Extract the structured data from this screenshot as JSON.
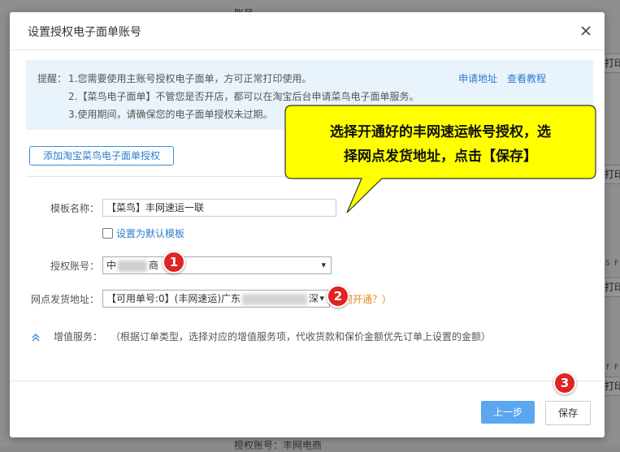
{
  "background": {
    "top_label": "账号",
    "bottom_label": "授权账号：丰网电商",
    "print_label": "打印",
    "snippet_a": "S F",
    "snippet_b": "f F"
  },
  "dialog": {
    "title": "设置授权电子面单账号",
    "close_icon": "close-icon"
  },
  "tips": {
    "label": "提醒：",
    "lines": [
      "1.您需要使用主账号授权电子面单，方可正常打印使用。",
      "2.【菜鸟电子面单】不管您是否开店，都可以在淘宝后台申请菜鸟电子面单服务。",
      "3.使用期间，请确保您的电子面单授权未过期。"
    ],
    "apply_link": "申请地址",
    "tutorial_link": "查看教程"
  },
  "add_auth_button": "添加淘宝菜鸟电子面单授权",
  "form": {
    "template_label": "模板名称：",
    "template_value": "【菜鸟】丰网速运一联",
    "default_checkbox_label": "设置为默认模板",
    "account_label": "授权账号：",
    "account_value_prefix": "中",
    "account_value_suffix": "商",
    "address_label": "网点发货地址：",
    "address_value_prefix": "【可用单号:0】(丰网速运)广东",
    "address_value_suffix": "深",
    "how_link": "何开通？）"
  },
  "value_added": {
    "label": "增值服务：",
    "description": "（根据订单类型，选择对应的增值服务项，代收货款和保价金额优先订单上设置的金额）"
  },
  "footer": {
    "prev_button": "上一步",
    "save_button": "保存"
  },
  "annotation": {
    "callout_line1": "选择开通好的丰网速运帐号授权，选",
    "callout_line2": "择网点发货地址，点击【保存】",
    "badge_1": "1",
    "badge_2": "2",
    "badge_3": "3",
    "badge_color": "#e02323",
    "callout_fill": "#ffff00"
  }
}
